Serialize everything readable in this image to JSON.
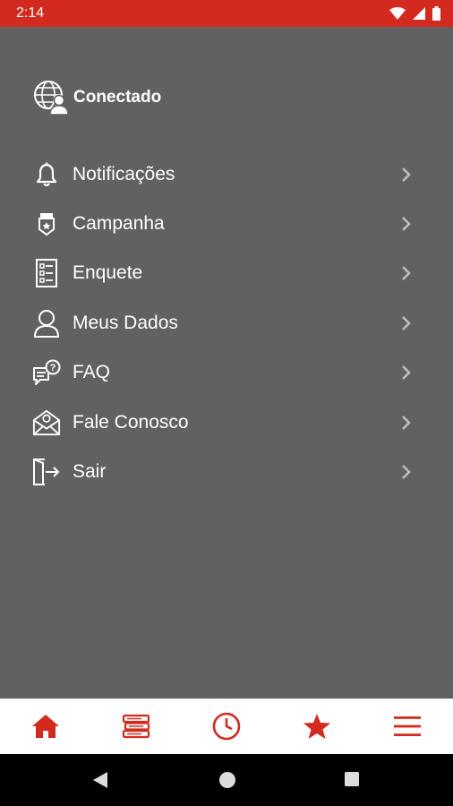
{
  "status_bar": {
    "time": "2:14"
  },
  "profile": {
    "name": "Conectado"
  },
  "menu": {
    "items": [
      {
        "label": "Notificações",
        "icon": "bell-icon"
      },
      {
        "label": "Campanha",
        "icon": "badge-icon"
      },
      {
        "label": "Enquete",
        "icon": "survey-icon"
      },
      {
        "label": "Meus Dados",
        "icon": "user-icon"
      },
      {
        "label": "FAQ",
        "icon": "faq-chat-icon"
      },
      {
        "label": "Fale Conosco",
        "icon": "mail-icon"
      },
      {
        "label": "Sair",
        "icon": "logout-icon"
      }
    ]
  },
  "bottom_nav": {
    "items": [
      {
        "icon": "home-icon"
      },
      {
        "icon": "books-icon"
      },
      {
        "icon": "clock-icon"
      },
      {
        "icon": "star-icon"
      },
      {
        "icon": "hamburger-menu-icon"
      }
    ]
  },
  "colors": {
    "accent": "#d32a1f",
    "drawer_bg": "#616161",
    "text": "#ffffff",
    "nav_bg": "#ffffff"
  }
}
